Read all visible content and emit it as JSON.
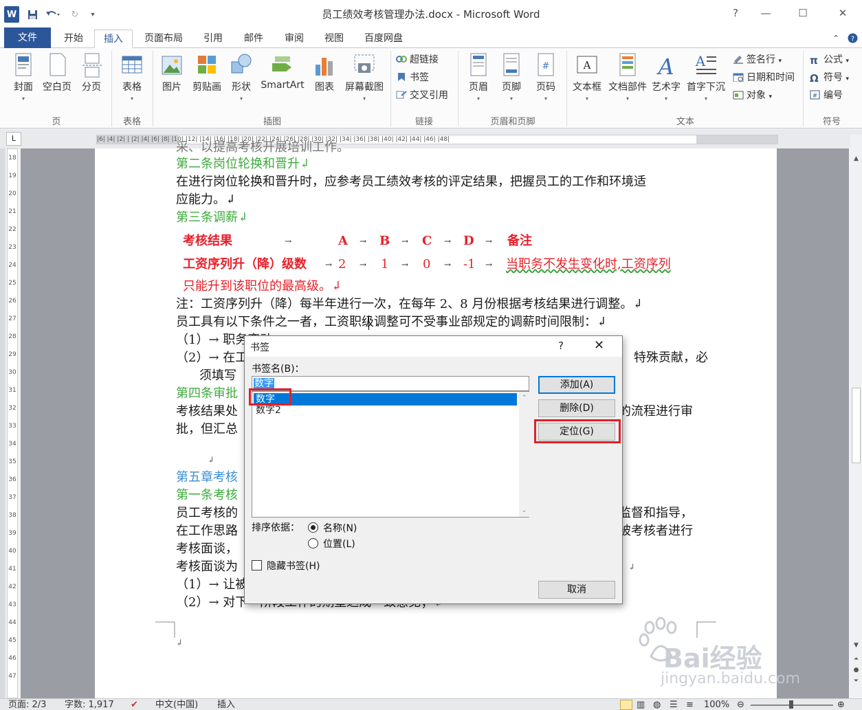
{
  "window": {
    "title": "员工绩效考核管理办法.docx - Microsoft Word",
    "app_icon": "W",
    "quick_access": {
      "save_icon": "save-icon",
      "undo_icon": "undo-icon",
      "redo_icon": "redo-icon"
    },
    "controls": {
      "minimize": "—",
      "maximize": "☐",
      "close": "✕"
    }
  },
  "tabs": [
    "文件",
    "开始",
    "插入",
    "页面布局",
    "引用",
    "邮件",
    "审阅",
    "视图",
    "百度网盘"
  ],
  "active_tab": "插入",
  "ribbon": {
    "groups": {
      "page": {
        "label": "页",
        "items": [
          "封面",
          "空白页",
          "分页"
        ]
      },
      "table": {
        "label": "表格",
        "items": [
          "表格"
        ]
      },
      "illustrations": {
        "label": "插图",
        "items": [
          "图片",
          "剪贴画",
          "形状",
          "SmartArt",
          "图表",
          "屏幕截图"
        ]
      },
      "links": {
        "label": "链接",
        "items": [
          "超链接",
          "书签",
          "交叉引用"
        ]
      },
      "header_footer": {
        "label": "页眉和页脚",
        "items": [
          "页眉",
          "页脚",
          "页码"
        ]
      },
      "text": {
        "label": "文本",
        "items": [
          "文本框",
          "文档部件",
          "艺术字",
          "首字下沉"
        ],
        "small": [
          "签名行",
          "日期和时间",
          "对象"
        ]
      },
      "symbols": {
        "label": "符号",
        "small": [
          "公式",
          "符号",
          "编号"
        ]
      }
    }
  },
  "ruler": {
    "h_ticks": "|6|  |4|  |2|  |  |2|  |4|  |6|  |8|  |10|  |12|  |14|  |16|  |18|  |20|  |22|  |24|  |26|  |28|  |30|  |32|  |34|  |36|  |38|  |40|  |42|  |44|  |46|  |48|",
    "v_ticks": [
      "18",
      "19",
      "20",
      "21",
      "22",
      "23",
      "24",
      "25",
      "26",
      "27",
      "28",
      "29",
      "30",
      "31",
      "32",
      "33",
      "34",
      "35",
      "36",
      "37",
      "38",
      "39",
      "40",
      "41",
      "42",
      "43",
      "44",
      "45",
      "46",
      "47"
    ]
  },
  "document": {
    "top_partial": "采、以提高考核开展培训工作。",
    "lines": {
      "l1": "第二条岗位轮换和晋升↲",
      "l2": "在进行岗位轮换和晋升时，应参考员工绩效考核的评定结果，把握员工的工作和环境适",
      "l3": "应能力。↲",
      "l4": "第三条调薪↲",
      "t_header": [
        "考核结果",
        "A",
        "B",
        "C",
        "D",
        "备注"
      ],
      "t_row_label": "工资序列升（降）级数",
      "t_row_values": [
        "2",
        "1",
        "0",
        "-1"
      ],
      "t_row_note": "当职务不发生变化时,工资序列",
      "t_row_note2": "只能升到该职位的最高级。↲",
      "l5": "注：工资序列升（降）每半年进行一次，在每年 2、8 月份根据考核结果进行调整。↲",
      "l6": "员工具有以下条件之一者，工资职级调整可不受事业部规定的调薪时间限制：↲",
      "l7": "（1）→ 职务变动；",
      "l8a": "（2）→ 在工",
      "l8b": "特殊贡献，必",
      "l9": "须填写",
      "l10": "第四条审批",
      "l11a": "考核结果处",
      "l11b": "的流程进行审",
      "l12": "批，但汇总",
      "l13": "↲",
      "l14": "第五章考核",
      "l15": "第一条考核",
      "l16a": "员工考核的",
      "l16b": "监督和指导，",
      "l17a": "在工作思路",
      "l17b": "被考核者进行",
      "l18": "考核面谈，",
      "l19a": "考核面谈为",
      "l19b": "↲",
      "l20": "（1）→ 让被",
      "l21": "（2）→ 对下一阶段工作的期望达成一致意见；↲",
      "l22": "↲"
    }
  },
  "dialog": {
    "title": "书签",
    "help": "?",
    "close": "✕",
    "name_label": "书签名(B)：",
    "name_value": "数字",
    "list": [
      "数字",
      "数字2"
    ],
    "selected_index": 0,
    "buttons": {
      "add": "添加(A)",
      "delete": "删除(D)",
      "goto": "定位(G)",
      "cancel": "取消"
    },
    "sort_label": "排序依据：",
    "sort_options": [
      "名称(N)",
      "位置(L)"
    ],
    "sort_selected": "名称(N)",
    "hidden_label": "隐藏书签(H)",
    "hidden_checked": false
  },
  "status": {
    "page": "页面: 2/3",
    "words": "字数: 1,917",
    "language": "中文(中国)",
    "mode": "插入",
    "zoom": "100%"
  },
  "watermark": {
    "brand": "Bai经验",
    "url": "jingyan.baidu.com"
  },
  "colors": {
    "file_tab": "#2b579a",
    "highlight": "#e0202a",
    "selection": "#0078d7",
    "heading_green": "#3eaa3e",
    "table_red": "#e8202a"
  }
}
